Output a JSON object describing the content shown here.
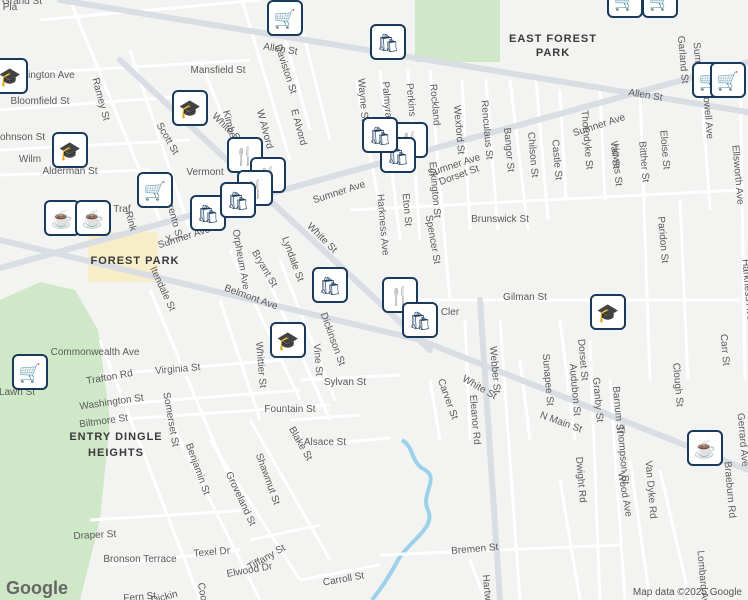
{
  "colors": {
    "background": "#f3f3f1",
    "road": "#ffffff",
    "arterial": "#d9dee4",
    "park": "#cfe8c8",
    "water": "#9dd1ea",
    "marker": "#1a3a5c",
    "marker_frame": "#ffffff"
  },
  "areas": [
    "EAST FOREST",
    "PARK",
    "FOREST PARK",
    "ENTRY DINGLE",
    "HEIGHTS"
  ],
  "streets": [
    "Grand St",
    "Allen St",
    "Allen St",
    "Sumner Ave",
    "Sumner Ave",
    "Sumner Ave",
    "Sumner Ave",
    "White St",
    "White St",
    "White St",
    "Belmont Ave",
    "N Main St",
    "Daviston St",
    "Mansfield St",
    "Kensington Ave",
    "Bloomfield St",
    "Ramey St",
    "Johnson St",
    "Wilm",
    "Alderman St",
    "Scott St",
    "Vermont",
    "Kimberly",
    "W Alvord",
    "E Alvord",
    "Wayne St",
    "Palmyra",
    "Perkins",
    "Rockland",
    "Wexford St",
    "Renculaus St",
    "Bangor St",
    "Chilson St",
    "Castle St",
    "Thorndyke St",
    "Howes St",
    "Bitther St",
    "Eloise St",
    "Vail St",
    "Garland St",
    "Powell Ave",
    "Ellsworth Ave",
    "Harkness Ave",
    "Harkness Ave",
    "Eton St",
    "Eckington St",
    "Dorset St",
    "Dorset St",
    "Spencer St",
    "Brunswick St",
    "Paridon St",
    "Gilman St",
    "Clough St",
    "Carr St",
    "Orpheum Ave",
    "Bryant St",
    "Lyndale St",
    "Whittier St",
    "Itendale St",
    "Commonwealth Ave",
    "Trafton Rd",
    "Virginia St",
    "Washington St",
    "Biltmore St",
    "Somerset St",
    "Dickinson St",
    "Sylvan St",
    "Fountain St",
    "Alsace St",
    "Blake St",
    "Carver St",
    "Eleanor Rd",
    "Webber St",
    "Sunapee St",
    "Audubon St",
    "Granby St",
    "Barnum St",
    "Thompson St",
    "Wood Ave",
    "Dwight Rd",
    "Van Dyke Rd",
    "Braeburn Rd",
    "Gerrard Ave",
    "Lombard Ave",
    "Benjamin St",
    "Groveland St",
    "Shawmut St",
    "Draper St",
    "Bronson Terrace",
    "Texel Dr",
    "Fern St",
    "Elwood Dr",
    "Tiffany St",
    "Carroll St",
    "Bremen St",
    "Hartwick St",
    "Coop",
    "Dickin",
    "Traf",
    "X",
    "Sumner",
    "Cler",
    "Vine St",
    "Lawn St",
    "Rink",
    "Sorrento St",
    "Pla"
  ],
  "markers": [
    "shopping-cart",
    "shopping-bag",
    "shopping-cart",
    "shopping-cart",
    "school",
    "school",
    "school",
    "school",
    "school",
    "restaurant",
    "restaurant",
    "restaurant",
    "restaurant",
    "restaurant",
    "shopping-bag",
    "shopping-bag",
    "shopping-bag",
    "shopping-bag",
    "shopping-bag",
    "shopping-bag",
    "cafe",
    "cafe",
    "cafe",
    "shopping-cart",
    "shopping-cart",
    "shopping-cart",
    "shopping-cart"
  ],
  "attribution": {
    "logo": "Google",
    "text": "Map data ©2025 Google"
  }
}
